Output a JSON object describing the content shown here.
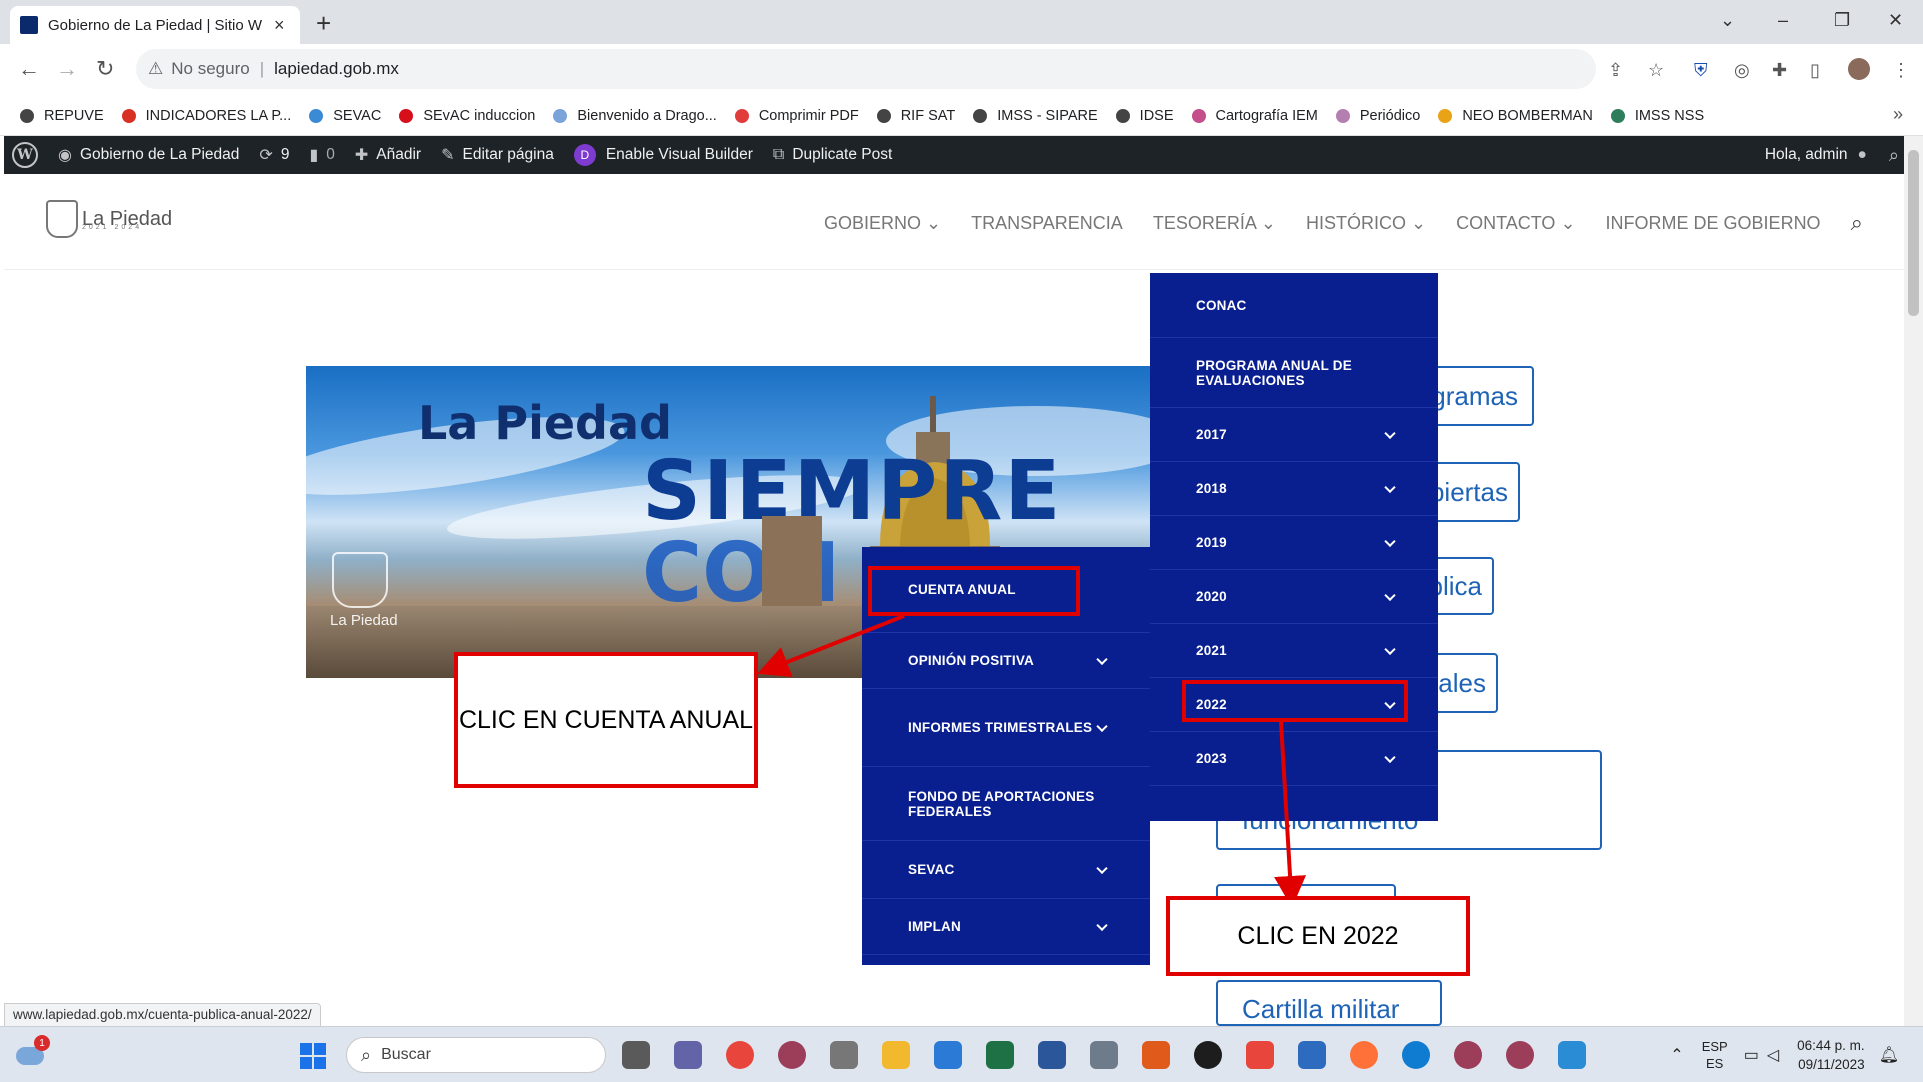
{
  "browser": {
    "tab_title": "Gobierno de La Piedad | Sitio W",
    "tab_close": "×",
    "new_tab": "+",
    "security_label": "No seguro",
    "url": "lapiedad.gob.mx",
    "window_controls": {
      "collapse": "⌄",
      "minimize": "–",
      "restore": "❐",
      "close": "✕"
    },
    "nav": {
      "back": "←",
      "forward": "→",
      "reload": "↻"
    }
  },
  "bookmarks": {
    "items": [
      {
        "label": "REPUVE",
        "color": "#444444"
      },
      {
        "label": "INDICADORES LA P...",
        "color": "#d93025"
      },
      {
        "label": "SEVAC",
        "color": "#3a8ad6"
      },
      {
        "label": "SEvAC induccion",
        "color": "#d60f1b"
      },
      {
        "label": "Bienvenido a Drago...",
        "color": "#7aa3d9"
      },
      {
        "label": "Comprimir PDF",
        "color": "#e23b3b"
      },
      {
        "label": "RIF SAT",
        "color": "#444444"
      },
      {
        "label": "IMSS - SIPARE",
        "color": "#444444"
      },
      {
        "label": "IDSE",
        "color": "#444444"
      },
      {
        "label": "Cartografía IEM",
        "color": "#c44f8a"
      },
      {
        "label": "Periódico",
        "color": "#b47fb0"
      },
      {
        "label": "NEO BOMBERMAN",
        "color": "#e8a317"
      },
      {
        "label": "IMSS NSS",
        "color": "#2e7d5b"
      }
    ],
    "more": "»"
  },
  "wpbar": {
    "site": "Gobierno de La Piedad",
    "updates": "9",
    "comments": "0",
    "add": "Añadir",
    "edit": "Editar página",
    "visual_builder": "Enable Visual Builder",
    "divi_letter": "D",
    "duplicate": "Duplicate Post",
    "greeting": "Hola, admin"
  },
  "site": {
    "logo_name": "La Piedad",
    "logo_years": "2021 2024",
    "nav": [
      "GOBIERNO",
      "TRANSPARENCIA",
      "TESORERÍA",
      "HISTÓRICO",
      "CONTACTO",
      "INFORME DE GOBIERNO"
    ]
  },
  "hero": {
    "title": "La Piedad",
    "word1": "SIEMPRE",
    "word2": "CON",
    "logo_text": "La Piedad"
  },
  "side_buttons": [
    "Programas",
    "Finanzas Abiertas",
    "Deuda Pública",
    "Estados Financieros Municipales",
    "funcionamiento",
    "",
    "Cartilla militar"
  ],
  "menu_tesoreria": [
    {
      "label": "CONAC",
      "arrow": false
    },
    {
      "label": "PROGRAMA ANUAL DE EVALUACIONES",
      "arrow": false
    },
    {
      "label": "2017",
      "arrow": true
    },
    {
      "label": "2018",
      "arrow": true
    },
    {
      "label": "2019",
      "arrow": true
    },
    {
      "label": "2020",
      "arrow": true
    },
    {
      "label": "2021",
      "arrow": true
    },
    {
      "label": "2022",
      "arrow": true
    },
    {
      "label": "2023",
      "arrow": true
    }
  ],
  "menu_2022": [
    {
      "label": "CUENTA ANUAL",
      "arrow": false
    },
    {
      "label": "OPINIÓN POSITIVA",
      "arrow": true
    },
    {
      "label": "INFORMES TRIMESTRALES",
      "arrow": true
    },
    {
      "label": "FONDO DE APORTACIONES FEDERALES",
      "arrow": false
    },
    {
      "label": "SEVAC",
      "arrow": true
    },
    {
      "label": "IMPLAN",
      "arrow": true
    }
  ],
  "annotations": {
    "callout_cuenta": "CLIC EN CUENTA ANUAL",
    "callout_2022": "CLIC EN 2022",
    "color": "#e00000"
  },
  "status_url": "www.lapiedad.gob.mx/cuenta-publica-anual-2022/",
  "taskbar": {
    "weather_badge": "1",
    "search_placeholder": "Buscar",
    "lang_top": "ESP",
    "lang_bottom": "ES",
    "time": "06:44 p. m.",
    "date": "09/11/2023",
    "app_colors": [
      "#5a5a5a",
      "#6264a7",
      "#e8453c",
      "#9c3d5a",
      "#777777",
      "#f2b92e",
      "#2a7ad6",
      "#1e7145",
      "#2b579a",
      "#6e7b8b",
      "#e05a1b",
      "#1d1d1d",
      "#e8453c",
      "#2d6bbf",
      "#ff7139",
      "#0f7cd1",
      "#9c3d5a",
      "#9c3d5a",
      "#2b8cd6"
    ]
  }
}
